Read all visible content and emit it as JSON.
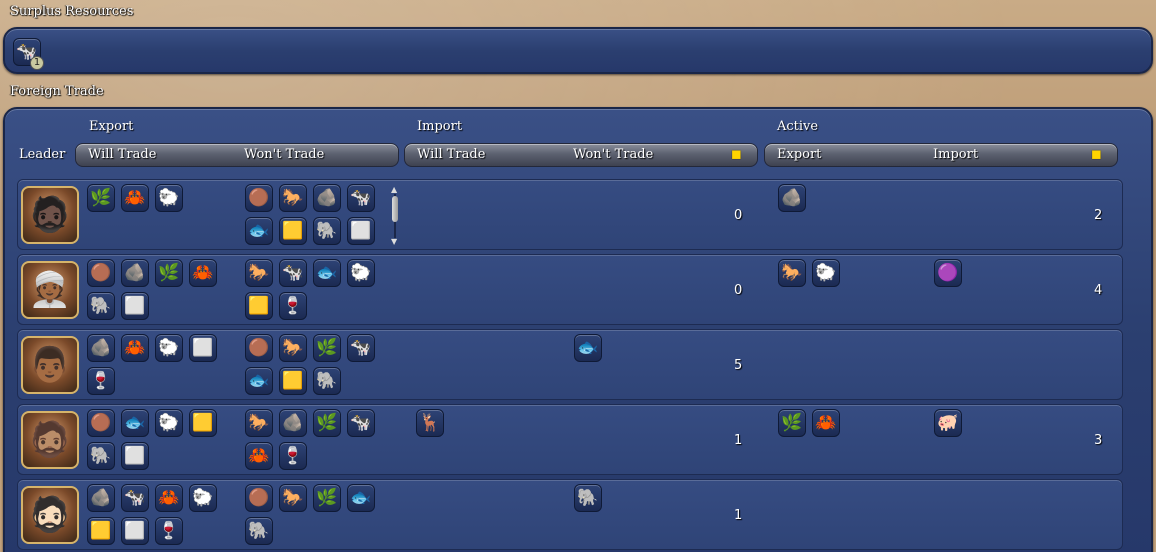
{
  "surplus": {
    "title": "Surplus Resources",
    "icons": [
      {
        "name": "cow-icon",
        "glyph": "🐄",
        "count": "1"
      }
    ]
  },
  "foreign": {
    "title": "Foreign Trade",
    "headers": {
      "leader": "Leader",
      "export": "Export",
      "import": "Import",
      "active": "Active",
      "will_trade": "Will Trade",
      "wont_trade": "Won't Trade",
      "active_export": "Export",
      "active_import": "Import"
    }
  },
  "resource_glyphs": {
    "banana": "🌿",
    "crab": "🦀",
    "sheep": "🐑",
    "copper": "🟤",
    "horse": "🐎",
    "stone": "🪨",
    "cow": "🐄",
    "fish": "🐟",
    "gold": "🟨",
    "elephant": "🐘",
    "iron": "⬜",
    "wine": "🍷",
    "deer": "🦌",
    "pig": "🐖",
    "dye": "🟣"
  },
  "rows": [
    {
      "leader": "leader-1",
      "portrait": "🧔🏿",
      "will": [
        "banana",
        "crab",
        "sheep"
      ],
      "wont": [
        "copper",
        "horse",
        "stone",
        "cow",
        "fish",
        "gold",
        "elephant",
        "iron"
      ],
      "has_scroll": true,
      "import_will": [],
      "import_wont": [],
      "import_gold": "0",
      "active_export": [
        "stone"
      ],
      "active_import": [],
      "active_gold": "2"
    },
    {
      "leader": "leader-2",
      "portrait": "👳🏾",
      "will": [
        "copper",
        "stone",
        "banana",
        "crab",
        "elephant",
        "iron"
      ],
      "wont": [
        "horse",
        "cow",
        "fish",
        "sheep",
        "gold",
        "wine"
      ],
      "has_scroll": false,
      "import_will": [],
      "import_wont": [],
      "import_gold": "0",
      "active_export": [
        "horse",
        "sheep"
      ],
      "active_import": [
        "dye"
      ],
      "active_gold": "4"
    },
    {
      "leader": "leader-3",
      "portrait": "👨🏾",
      "will": [
        "stone",
        "crab",
        "sheep",
        "iron",
        "wine"
      ],
      "wont": [
        "copper",
        "horse",
        "banana",
        "cow",
        "fish",
        "gold",
        "elephant"
      ],
      "has_scroll": false,
      "import_will": [],
      "import_wont": [
        "fish"
      ],
      "import_gold": "5",
      "active_export": [],
      "active_import": [],
      "active_gold": ""
    },
    {
      "leader": "leader-4",
      "portrait": "🧔🏽",
      "will": [
        "copper",
        "fish",
        "sheep",
        "gold",
        "elephant",
        "iron"
      ],
      "wont": [
        "horse",
        "stone",
        "banana",
        "cow",
        "crab",
        "wine"
      ],
      "has_scroll": false,
      "import_will": [
        "deer"
      ],
      "import_wont": [],
      "import_gold": "1",
      "active_export": [
        "banana",
        "crab"
      ],
      "active_import": [
        "pig"
      ],
      "active_gold": "3"
    },
    {
      "leader": "leader-5",
      "portrait": "🧔🏻",
      "will": [
        "stone",
        "cow",
        "crab",
        "sheep",
        "gold",
        "iron",
        "wine"
      ],
      "wont": [
        "copper",
        "horse",
        "banana",
        "fish",
        "elephant"
      ],
      "has_scroll": false,
      "import_will": [],
      "import_wont": [
        "elephant"
      ],
      "import_gold": "1",
      "active_export": [],
      "active_import": [],
      "active_gold": ""
    }
  ]
}
